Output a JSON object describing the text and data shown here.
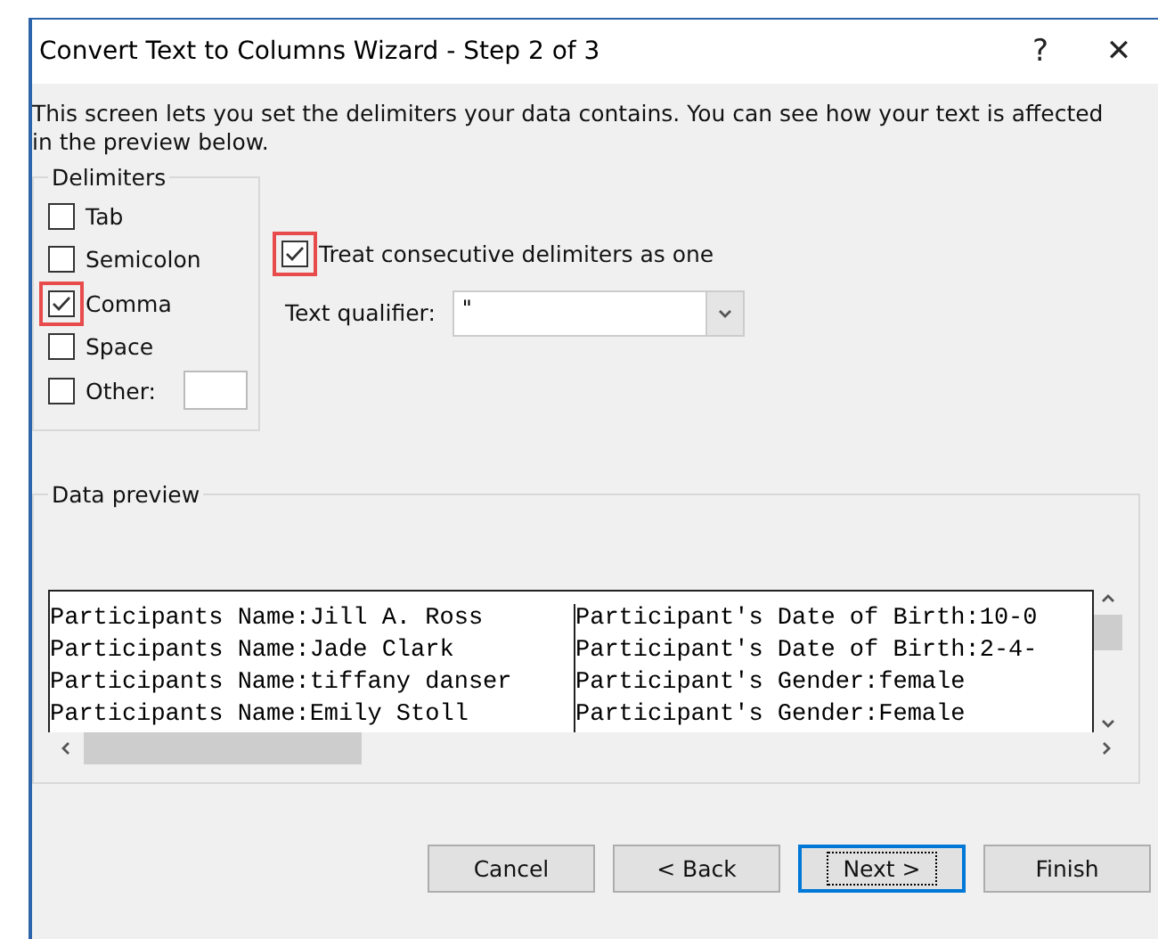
{
  "window": {
    "title": "Convert Text to Columns Wizard - Step 2 of 3",
    "help": "?",
    "close": "✕"
  },
  "intro": "This screen lets you set the delimiters your data contains.  You can see how your text is affected in the preview below.",
  "delimiters": {
    "title": "Delimiters",
    "items": [
      {
        "label": "Tab",
        "checked": false,
        "highlighted": false
      },
      {
        "label": "Semicolon",
        "checked": false,
        "highlighted": false
      },
      {
        "label": "Comma",
        "checked": true,
        "highlighted": true
      },
      {
        "label": "Space",
        "checked": false,
        "highlighted": false
      },
      {
        "label": "Other:",
        "checked": false,
        "highlighted": false,
        "kind": "other"
      }
    ]
  },
  "consecutive": {
    "label": "Treat consecutive delimiters as one",
    "checked": true,
    "highlighted": true
  },
  "qualifier": {
    "label": "Text qualifier:",
    "value": "\""
  },
  "preview": {
    "title": "Data preview",
    "rows": [
      [
        "Participants Name:Jill A. Ross",
        "Participant's Date of Birth:10-0"
      ],
      [
        "Participants Name:Jade Clark",
        "Participant's Date of Birth:2-4-"
      ],
      [
        "Participants Name:tiffany danser",
        "Participant's Gender:female"
      ],
      [
        "Participants Name:Emily Stoll",
        "Participant's Gender:Female"
      ]
    ]
  },
  "buttons": [
    {
      "label": "Cancel",
      "default": false
    },
    {
      "label": "< Back",
      "default": false
    },
    {
      "label": "Next >",
      "default": true
    },
    {
      "label": "Finish",
      "default": false
    }
  ]
}
